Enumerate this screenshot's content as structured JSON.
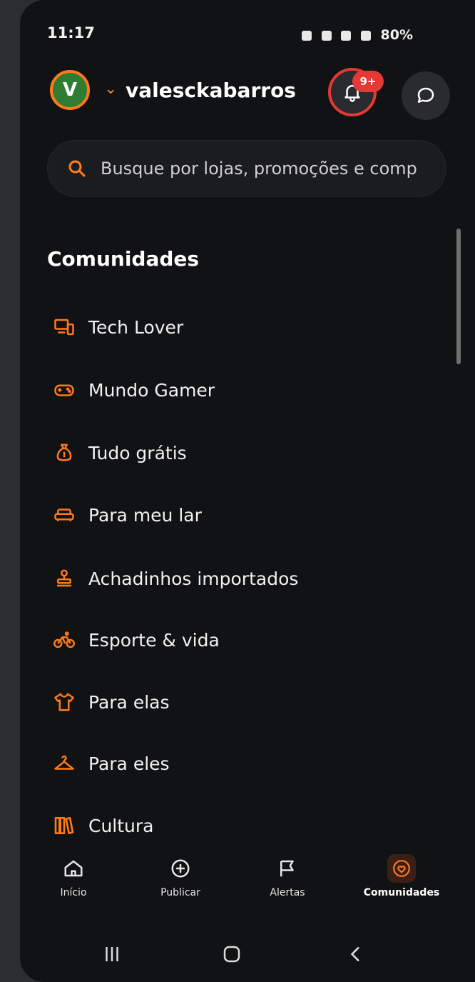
{
  "status_bar": {
    "time": "11:17",
    "right": "80%"
  },
  "header": {
    "avatar_letter": "V",
    "username": "valesckabarros",
    "notifications_badge": "9+"
  },
  "search": {
    "placeholder": "Busque por lojas, promoções e comp"
  },
  "communities": {
    "title": "Comunidades",
    "items": [
      {
        "label": "Tech Lover",
        "icon": "devices-icon"
      },
      {
        "label": "Mundo Gamer",
        "icon": "gamepad-icon"
      },
      {
        "label": "Tudo grátis",
        "icon": "money-bag-icon"
      },
      {
        "label": "Para meu lar",
        "icon": "sofa-icon"
      },
      {
        "label": "Achadinhos importados",
        "icon": "stamp-icon"
      },
      {
        "label": "Esporte & vida",
        "icon": "bicycle-icon"
      },
      {
        "label": "Para elas",
        "icon": "shirt-icon"
      },
      {
        "label": "Para eles",
        "icon": "hanger-icon"
      },
      {
        "label": "Cultura",
        "icon": "books-icon"
      }
    ]
  },
  "bottom_nav": {
    "home": "Início",
    "publish": "Publicar",
    "alerts": "Alertas",
    "communities": "Comunidades"
  },
  "colors": {
    "accent": "#ff7a1a",
    "alert_red": "#e53935",
    "background": "#111214"
  }
}
